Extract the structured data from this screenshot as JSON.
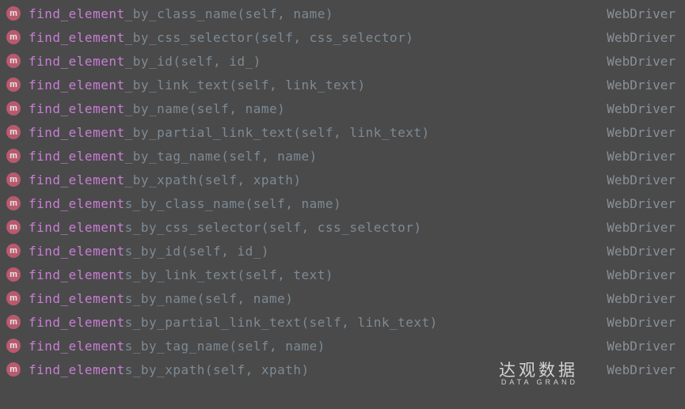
{
  "icon_letter": "m",
  "class_label": "WebDriver",
  "highlight_prefix": "find_element",
  "items": [
    {
      "rest": "_by_class_name(self, name)"
    },
    {
      "rest": "_by_css_selector(self, css_selector)"
    },
    {
      "rest": "_by_id(self, id_)"
    },
    {
      "rest": "_by_link_text(self, link_text)"
    },
    {
      "rest": "_by_name(self, name)"
    },
    {
      "rest": "_by_partial_link_text(self, link_text)"
    },
    {
      "rest": "_by_tag_name(self, name)"
    },
    {
      "rest": "_by_xpath(self, xpath)"
    },
    {
      "rest": "s_by_class_name(self, name)"
    },
    {
      "rest": "s_by_css_selector(self, css_selector)"
    },
    {
      "rest": "s_by_id(self, id_)"
    },
    {
      "rest": "s_by_link_text(self, text)"
    },
    {
      "rest": "s_by_name(self, name)"
    },
    {
      "rest": "s_by_partial_link_text(self, link_text)"
    },
    {
      "rest": "s_by_tag_name(self, name)"
    },
    {
      "rest": "s_by_xpath(self, xpath)"
    }
  ],
  "watermark": {
    "cn": "达观数据",
    "en": "DATA GRAND"
  }
}
